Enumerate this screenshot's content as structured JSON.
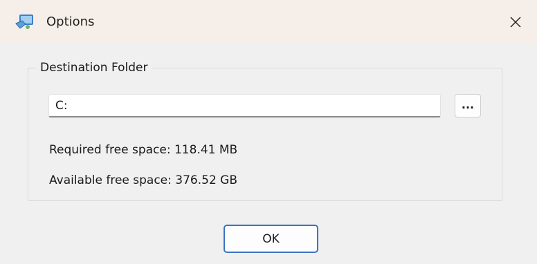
{
  "window": {
    "title": "Options",
    "app_icon": "setup-app-icon",
    "close_icon": "close-icon"
  },
  "destination": {
    "group_label": "Destination Folder",
    "path_value": "C:",
    "browse_label": "...",
    "required_space": "Required free space: 118.41 MB",
    "available_space": "Available free space: 376.52 GB"
  },
  "footer": {
    "ok_label": "OK"
  },
  "colors": {
    "titlebar_bg": "#f6efe9",
    "dialog_bg": "#f0f0f0",
    "default_button_border": "#3b73c4"
  }
}
